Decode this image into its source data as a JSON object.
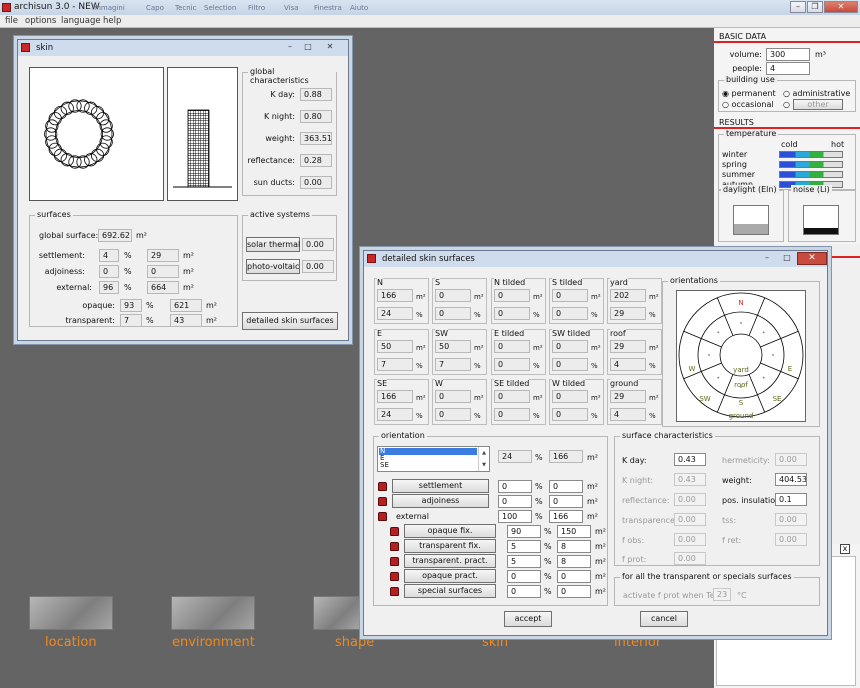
{
  "app": {
    "title": "archisun 3.0 - NEW",
    "menu": [
      "file",
      "options",
      "language",
      "help"
    ],
    "faint_menu": [
      "Immagini",
      "Capo",
      "Tecnic",
      "Selection",
      "Filtro",
      "Visa",
      "Finestra",
      "Aiuto"
    ]
  },
  "right_panel": {
    "basic_data": {
      "title": "BASIC DATA",
      "volume_label": "volume:",
      "volume": "300",
      "volume_unit": "m³",
      "people_label": "people:",
      "people": "4"
    },
    "building_use": {
      "title": "building use",
      "permanent": "permanent",
      "administrative": "administrative",
      "occasional": "occasional",
      "other": "other"
    },
    "results": {
      "title": "RESULTS",
      "temperature": "temperature",
      "cold": "cold",
      "hot": "hot",
      "seasons": [
        "winter",
        "spring",
        "summer",
        "autumn"
      ],
      "daylight": "daylight (Eln)",
      "noise": "noise (Li)"
    },
    "close_x": "x"
  },
  "nav": [
    "location",
    "environment",
    "shape",
    "skin",
    "interior"
  ],
  "skin": {
    "title": "skin",
    "global": {
      "title": "global characteristics",
      "k_day_label": "K day:",
      "k_day": "0.88",
      "k_night_label": "K night:",
      "k_night": "0.80",
      "weight_label": "weight:",
      "weight": "363.51",
      "reflectance_label": "reflectance:",
      "reflectance": "0.28",
      "sun_ducts_label": "sun ducts:",
      "sun_ducts": "0.00"
    },
    "surfaces": {
      "title": "surfaces",
      "global_label": "global surface:",
      "global": "692.62",
      "m2": "m²",
      "pct": "%",
      "settlement_label": "settlement:",
      "settlement_pct": "4",
      "settlement_m2": "29",
      "adjoiness_label": "adjoiness:",
      "adjoiness_pct": "0",
      "adjoiness_m2": "0",
      "external_label": "external:",
      "external_pct": "96",
      "external_m2": "664",
      "opaque_label": "opaque:",
      "opaque_pct": "93",
      "opaque_m2": "621",
      "transparent_label": "transparent:",
      "transparent_pct": "7",
      "transparent_m2": "43"
    },
    "active": {
      "title": "active systems",
      "solar_label": "solar thermal",
      "solar": "0.00",
      "pv_label": "photo-voltaic",
      "pv": "0.00"
    },
    "detailed_button": "detailed skin surfaces"
  },
  "detail": {
    "title": "detailed skin surfaces",
    "m2": "m²",
    "pct": "%",
    "cells": [
      {
        "name": "N",
        "m2": "166",
        "pct": "24"
      },
      {
        "name": "S",
        "m2": "0",
        "pct": "0"
      },
      {
        "name": "N tilded",
        "m2": "0",
        "pct": "0"
      },
      {
        "name": "S tilded",
        "m2": "0",
        "pct": "0"
      },
      {
        "name": "yard",
        "m2": "202",
        "pct": "29"
      },
      {
        "name": "E",
        "m2": "50",
        "pct": "7"
      },
      {
        "name": "SW",
        "m2": "50",
        "pct": "7"
      },
      {
        "name": "E tilded",
        "m2": "0",
        "pct": "0"
      },
      {
        "name": "SW tilded",
        "m2": "0",
        "pct": "0"
      },
      {
        "name": "roof",
        "m2": "29",
        "pct": "4"
      },
      {
        "name": "SE",
        "m2": "166",
        "pct": "24"
      },
      {
        "name": "W",
        "m2": "0",
        "pct": "0"
      },
      {
        "name": "SE tilded",
        "m2": "0",
        "pct": "0"
      },
      {
        "name": "W tilded",
        "m2": "0",
        "pct": "0"
      },
      {
        "name": "ground",
        "m2": "29",
        "pct": "4"
      }
    ],
    "orientations": {
      "title": "orientations",
      "labels": [
        "N",
        "E",
        "S",
        "W",
        "SW",
        "SE",
        "yard",
        "roof",
        "ground"
      ]
    },
    "orientation": {
      "title": "orientation",
      "list": [
        "N",
        "E",
        "SE"
      ],
      "pct": "24",
      "m2": "166",
      "settlement_label": "settlement",
      "settlement_pct": "0",
      "settlement_m2": "0",
      "adjoiness_label": "adjoiness",
      "adjoiness_pct": "0",
      "adjoiness_m2": "0",
      "external_label": "external",
      "external_pct": "100",
      "external_m2": "166",
      "opaque_fix_label": "opaque fix.",
      "opaque_fix_pct": "90",
      "opaque_fix_m2": "150",
      "transparent_fix_label": "transparent fix.",
      "transparent_fix_pct": "5",
      "transparent_fix_m2": "8",
      "transparent_pract_label": "transparent. pract.",
      "transparent_pract_pct": "5",
      "transparent_pract_m2": "8",
      "opaque_pract_label": "opaque pract.",
      "opaque_pract_pct": "0",
      "opaque_pract_m2": "0",
      "special_label": "special surfaces",
      "special_pct": "0",
      "special_m2": "0"
    },
    "surface_char": {
      "title": "surface characteristics",
      "k_day_label": "K day:",
      "k_day": "0.43",
      "hermeticity_label": "hermeticity:",
      "hermeticity": "0.00",
      "k_night_label": "K night:",
      "k_night": "0.43",
      "weight_label": "weight:",
      "weight": "404.53",
      "reflectance_label": "reflectance:",
      "reflectance": "0.00",
      "pos_ins_label": "pos. insulation:",
      "pos_ins": "0.1",
      "transparence_label": "transparence:",
      "transparence": "0.00",
      "tss_label": "tss:",
      "tss": "0.00",
      "f_obs_label": "f obs:",
      "f_obs": "0.00",
      "f_ret_label": "f ret:",
      "f_ret": "0.00",
      "f_prot_label": "f prot:",
      "f_prot": "0.00"
    },
    "transparent_all": {
      "title": "for all the transparent or specials surfaces",
      "label": "activate f prot when Te >",
      "value": "23",
      "unit": "°C"
    },
    "accept": "accept",
    "cancel": "cancel"
  }
}
